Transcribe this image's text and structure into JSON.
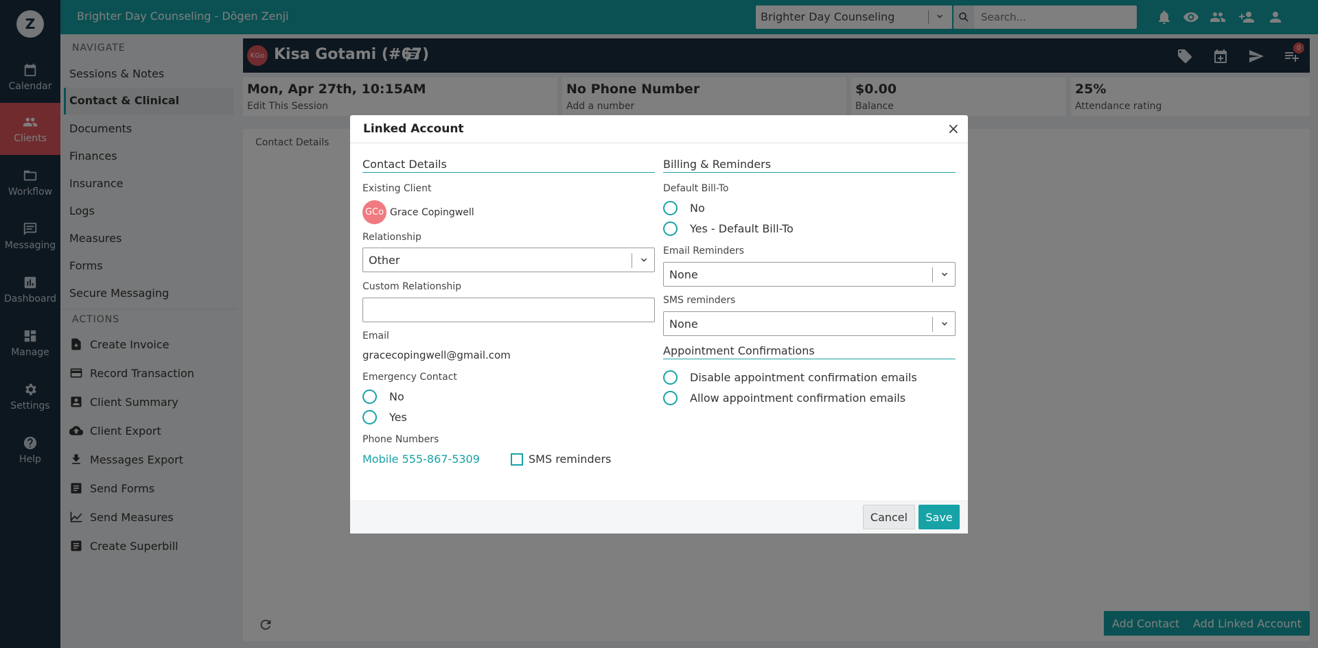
{
  "app": {
    "logo_letter": "Z",
    "title": "Brighter Day Counseling - Dōgen Zenji",
    "org_select": "Brighter Day Counseling",
    "search_placeholder": "Search..."
  },
  "rail": {
    "items": [
      {
        "label": "Calendar",
        "icon": "calendar-icon"
      },
      {
        "label": "Clients",
        "icon": "clients-icon",
        "active": true
      },
      {
        "label": "Workflow",
        "icon": "folder-icon"
      },
      {
        "label": "Messaging",
        "icon": "message-icon"
      },
      {
        "label": "Dashboard",
        "icon": "chart-icon"
      },
      {
        "label": "Manage",
        "icon": "grid-icon"
      },
      {
        "label": "Settings",
        "icon": "gear-icon"
      },
      {
        "label": "Help",
        "icon": "help-icon"
      }
    ]
  },
  "nav": {
    "navigate_header": "NAVIGATE",
    "items": [
      "Sessions & Notes",
      "Contact & Clinical",
      "Documents",
      "Finances",
      "Insurance",
      "Logs",
      "Measures",
      "Forms",
      "Secure Messaging"
    ],
    "actions_header": "ACTIONS",
    "actions": [
      "Create Invoice",
      "Record Transaction",
      "Client Summary",
      "Client Export",
      "Messages Export",
      "Send Forms",
      "Send Measures",
      "Create Superbill"
    ]
  },
  "client": {
    "initials": "KGo",
    "name": "Kisa Gotami (#67)",
    "badge_count": "0"
  },
  "stats": [
    {
      "value": "Mon, Apr 27th, 10:15AM",
      "label": "Edit This Session"
    },
    {
      "value": "No Phone Number",
      "label": "Add a number"
    },
    {
      "value": "$0.00",
      "label": "Balance"
    },
    {
      "value": "25%",
      "label": "Attendance rating"
    }
  ],
  "content": {
    "tab": "Contact Details",
    "add_contact": "Add Contact",
    "add_linked": "Add Linked Account"
  },
  "modal": {
    "title": "Linked Account",
    "close": "×",
    "contact_section": "Contact Details",
    "existing_client_label": "Existing Client",
    "client_initials": "GCo",
    "client_name": "Grace Copingwell",
    "relationship_label": "Relationship",
    "relationship_value": "Other",
    "custom_relationship_label": "Custom Relationship",
    "email_label": "Email",
    "email_value": "gracecopingwell@gmail.com",
    "emergency_label": "Emergency Contact",
    "emergency_no": "No",
    "emergency_yes": "Yes",
    "phone_label": "Phone Numbers",
    "phone_value": "Mobile 555-867-5309",
    "sms_checkbox": "SMS reminders",
    "billing_section": "Billing & Reminders",
    "bill_to_label": "Default Bill-To",
    "bill_no": "No",
    "bill_yes": "Yes - Default Bill-To",
    "email_reminders_label": "Email Reminders",
    "email_reminders_value": "None",
    "sms_reminders_label": "SMS reminders",
    "sms_reminders_value": "None",
    "confirm_section": "Appointment Confirmations",
    "confirm_disable": "Disable appointment confirmation emails",
    "confirm_allow": "Allow appointment confirmation emails",
    "cancel": "Cancel",
    "save": "Save"
  }
}
